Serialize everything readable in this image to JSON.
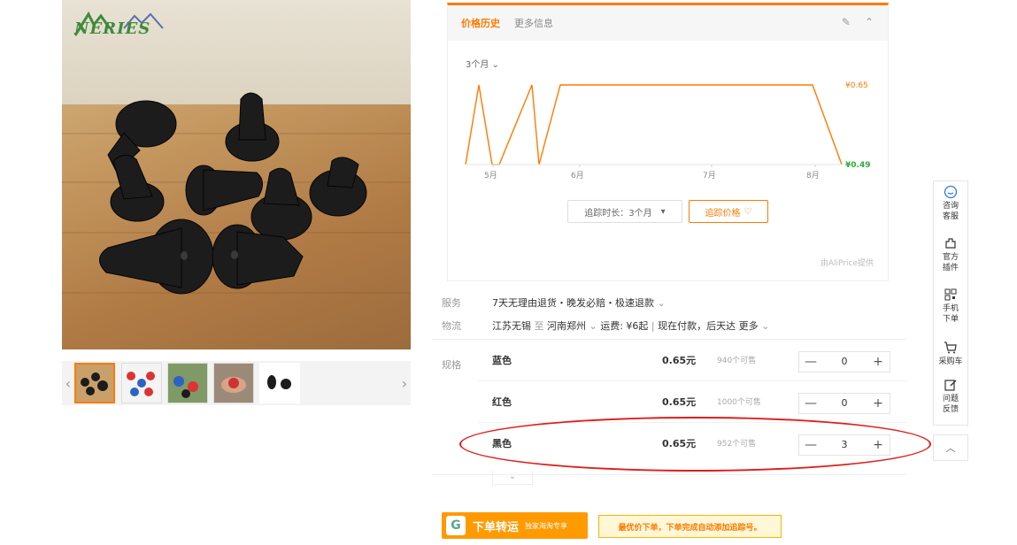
{
  "product": {
    "logo_text": "NERIES",
    "thumb_prev": "‹",
    "thumb_next": "›"
  },
  "price_history": {
    "tab_active": "价格历史",
    "tab_other": "更多信息",
    "period": "3个月",
    "track_duration": "追踪时长：3个月",
    "track_price": "追踪价格",
    "provider": "由AliPrice提供",
    "chart_data": {
      "type": "line",
      "x": [
        "5月",
        "6月",
        "7月",
        "8月"
      ],
      "y_high_label": "¥0.65",
      "y_low_label": "¥0.49",
      "ylim": [
        0.49,
        0.65
      ],
      "series": [
        {
          "values": [
            0.49,
            0.65,
            0.49,
            0.49,
            0.65,
            0.49,
            0.65,
            0.65,
            0.65,
            0.49
          ]
        }
      ]
    },
    "line_color": "#ff7a00",
    "high_color": "#ff7a00",
    "low_color": "#2eaa3a"
  },
  "info": {
    "service_label": "服务",
    "service_value": "7天无理由退货・晚发必赔・极速退款",
    "logistics_label": "物流",
    "logistics_from": "江苏无锡",
    "logistics_to_word": "至",
    "logistics_to": "河南郑州",
    "logistics_fee": "运费: ¥6起",
    "logistics_pay": "现在付款，后天达",
    "logistics_more": "更多",
    "spec_label": "规格"
  },
  "specs": [
    {
      "name": "蓝色",
      "price": "0.65元",
      "stock": "940个可售",
      "qty": "0"
    },
    {
      "name": "红色",
      "price": "0.65元",
      "stock": "1000个可售",
      "qty": "0"
    },
    {
      "name": "黑色",
      "price": "0.65元",
      "stock": "952个可售",
      "qty": "3"
    }
  ],
  "stepper": {
    "minus": "—",
    "plus": "+"
  },
  "banner": {
    "logo": "G",
    "title": "下单转运",
    "subtitle": "独家海淘专享",
    "promo": "最优价下单，下单完成自动添加追踪号。"
  },
  "sidebar": {
    "consult": "咨询客服",
    "plugin": "官方插件",
    "mobile": "手机下单",
    "cart": "采购车",
    "feedback": "问题反馈"
  },
  "accent_color": "#ff7a00",
  "highlight_color": "#e01b1b"
}
